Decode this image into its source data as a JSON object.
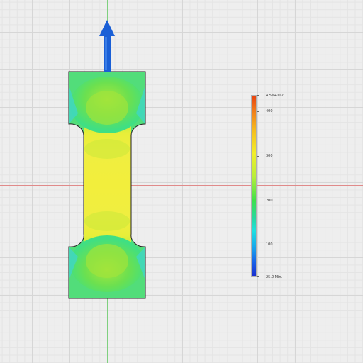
{
  "viewport": {
    "background_color": "#eeeeee",
    "x_axis_color": "#e08a8a",
    "y_axis_color": "#7fd07f"
  },
  "model": {
    "type": "tensile-test-specimen",
    "load_arrow": {
      "icon": "arrow-up-icon",
      "color": "#1a5fd6"
    },
    "outline_color": "#222222"
  },
  "legend": {
    "labels": {
      "max": "4.5e+002",
      "l1": "400",
      "l2": "300",
      "l3": "200",
      "l4": "100",
      "min": "25.0 Min."
    },
    "colors": {
      "high": "#e8420f",
      "mid": "#f2ee2a",
      "low": "#1a2fd0"
    }
  }
}
